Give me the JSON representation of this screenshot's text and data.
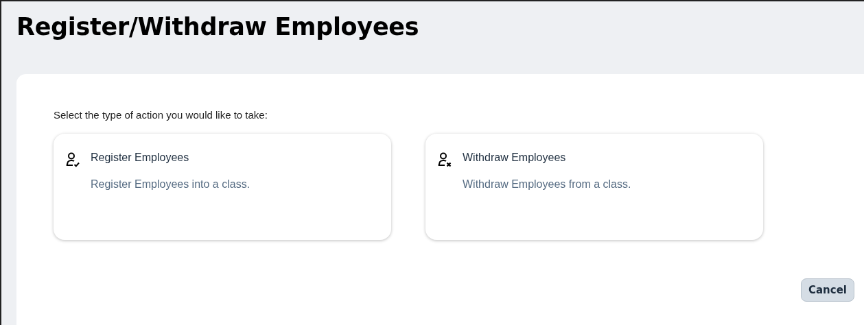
{
  "page": {
    "title": "Register/Withdraw Employees"
  },
  "prompt": "Select the type of action you would like to take:",
  "options": [
    {
      "kind": "add",
      "title": "Register Employees",
      "description": "Register Employees into a class."
    },
    {
      "kind": "remove",
      "title": "Withdraw Employees",
      "description": "Withdraw Employees from a class."
    }
  ],
  "buttons": [
    "Cancel"
  ]
}
